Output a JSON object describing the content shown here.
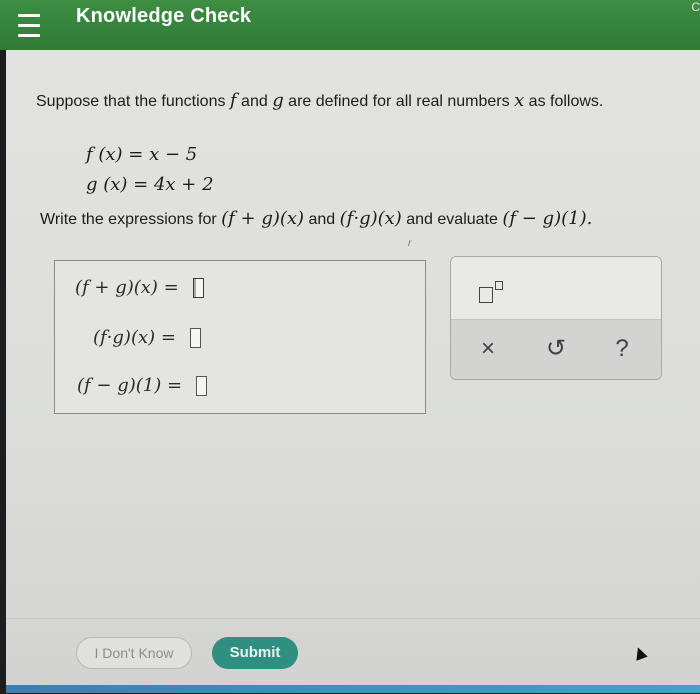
{
  "header": {
    "title": "Knowledge Check",
    "edge_glyph": "C"
  },
  "problem": {
    "prompt_pre": "Suppose that the functions ",
    "f": "f",
    "and": " and ",
    "g": "g",
    "prompt_mid": " are defined for all real numbers ",
    "x": "x",
    "prompt_post": " as follows.",
    "def_f": "f (x) = x − 5",
    "def_g": "g (x) = 4x + 2",
    "instr_pre": "Write the expressions for ",
    "expr_sum": "(f + g)(x)",
    "instr_and": " and ",
    "expr_prod": "(f·g)(x)",
    "instr_eval": " and evaluate ",
    "expr_diff": "(f − g)(1).",
    "stray_mark": "r"
  },
  "answers": [
    {
      "label": "(f + g)(x) =",
      "value": ""
    },
    {
      "label": "(f·g)(x) =",
      "value": ""
    },
    {
      "label": "(f − g)(1) =",
      "value": ""
    }
  ],
  "tools": {
    "superscript": "superscript-tool",
    "clear": "×",
    "undo": "↺",
    "help": "?"
  },
  "actions": {
    "dont_know": "I Don't Know",
    "submit": "Submit"
  }
}
